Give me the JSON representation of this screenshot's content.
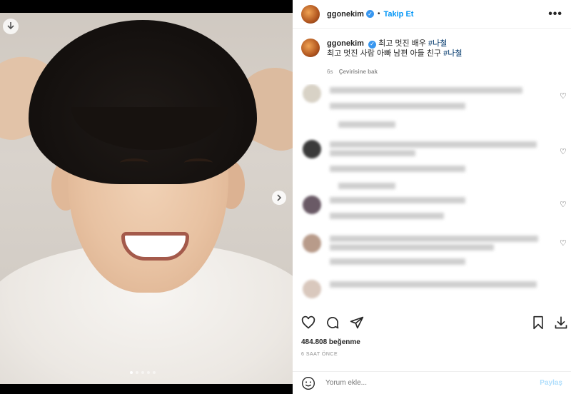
{
  "post": {
    "username": "ggonekim",
    "verified_mark": "✓",
    "separator": "•",
    "follow_label": "Takip Et",
    "more_label": "•••",
    "caption_line1": "최고 멋진 배우 ",
    "caption_tag1": "#나철",
    "caption_line2": "최고 멋진 사람 아빠 남편 아들 친구 ",
    "caption_tag2": "#나철",
    "caption_age": "6s",
    "see_translation": "Çevirisine bak",
    "likes": "484.808 beğenme",
    "timestamp": "6 SAAT ÖNCE",
    "comment_placeholder": "Yorum ekle...",
    "share_label": "Paylaş"
  },
  "icons": {
    "download": "download-icon",
    "next": "chevron-right-icon",
    "like": "heart-icon",
    "comment": "comment-icon",
    "share": "send-icon",
    "save": "bookmark-icon",
    "download_right": "download-icon",
    "emoji": "emoji-icon"
  },
  "carousel": {
    "count": 5,
    "active": 1
  },
  "colors": {
    "accent": "#0095f6",
    "verified": "#3897f0",
    "hashtag": "#00376b",
    "muted": "#8e8e8e"
  }
}
